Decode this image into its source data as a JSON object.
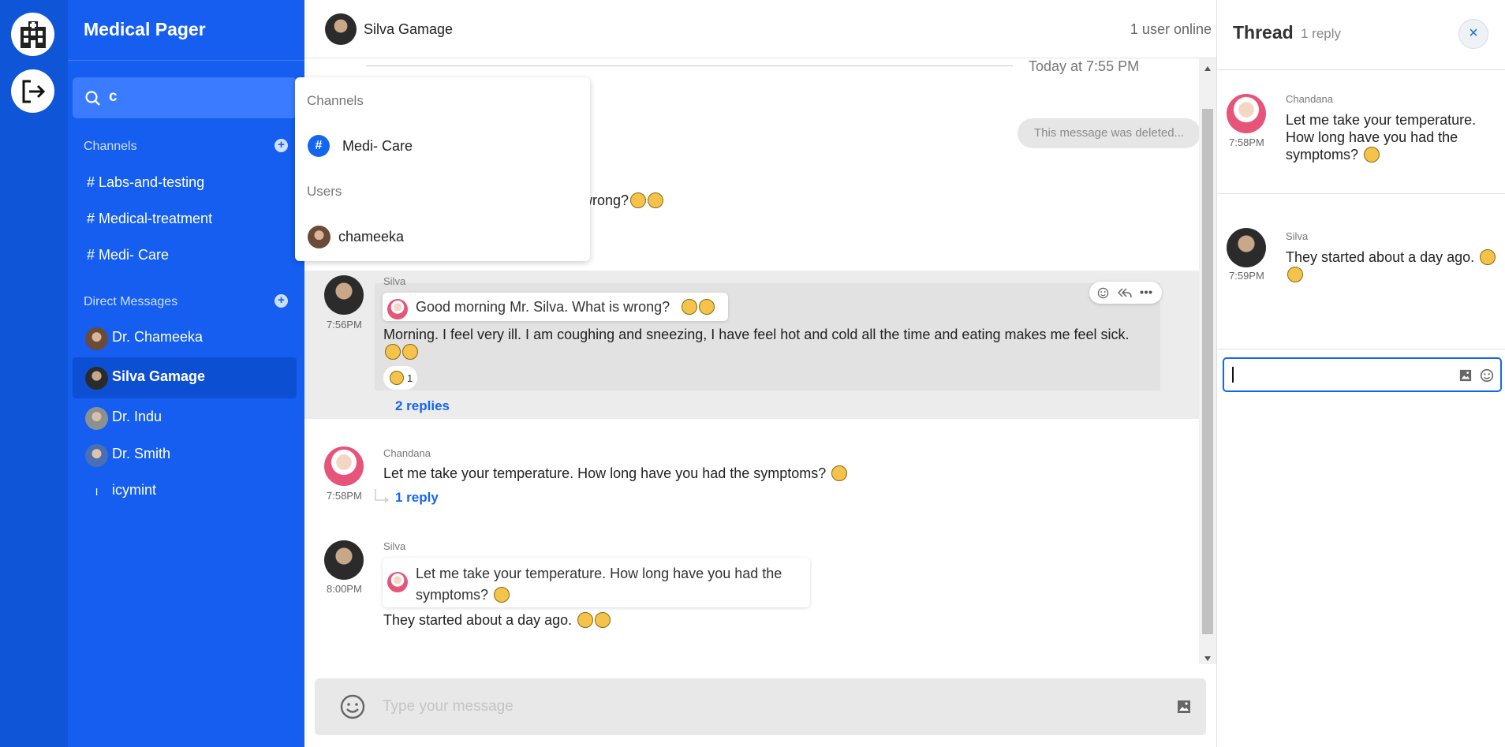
{
  "sidebar": {
    "brand": "Medical Pager",
    "search_value": "c",
    "channels_heading": "Channels",
    "channels": [
      "# Labs-and-testing",
      "# Medical-treatment",
      "# Medi- Care"
    ],
    "dm_heading": "Direct Messages",
    "direct_messages": [
      {
        "name": "Dr. Chameeka",
        "avatar": "user-avatar",
        "active": false
      },
      {
        "name": "Silva Gamage",
        "avatar": "user-avatar",
        "active": true
      },
      {
        "name": "Dr. Indu",
        "avatar": "user-avatar",
        "active": false
      },
      {
        "name": "Dr. Smith",
        "avatar": "user-avatar",
        "active": false
      },
      {
        "name": "icymint",
        "avatar": "I",
        "active": false
      }
    ]
  },
  "search_dropdown": {
    "channels_heading": "Channels",
    "channel": "Medi- Care",
    "users_heading": "Users",
    "user": "chameeka"
  },
  "chat": {
    "header_name": "Silva Gamage",
    "online": "1 user online",
    "date_divider": "Today at 7:55 PM",
    "deleted_notice": "This message was deleted...",
    "partial_text": "s wrong?",
    "messages": [
      {
        "sender": "Silva",
        "time": "7:56PM",
        "quote": "Good morning Mr. Silva. What is wrong?",
        "text": "Morning. I feel very ill. I am coughing and sneezing, I have feel hot and cold all the time and eating makes me feel sick.",
        "reaction_count": "1",
        "replies": "2 replies"
      },
      {
        "sender": "Chandana",
        "time": "7:58PM",
        "text": "Let me take your temperature. How long have you had the symptoms?",
        "replies": "1 reply"
      },
      {
        "sender": "Silva",
        "time": "8:00PM",
        "quote": "Let me take your temperature. How long have you had the symptoms?",
        "text": "They started about a day ago."
      }
    ],
    "compose_placeholder": "Type your message"
  },
  "thread": {
    "title": "Thread",
    "count": "1 reply",
    "messages": [
      {
        "sender": "Chandana",
        "time": "7:58PM",
        "text": "Let me take your temperature. How long have you had the symptoms?"
      },
      {
        "sender": "Silva",
        "time": "7:59PM",
        "text": "They started about a day ago."
      }
    ]
  },
  "colors": {
    "rail": "#0e55d8",
    "sidebar": "#155ef0",
    "accent": "#1466f0"
  }
}
